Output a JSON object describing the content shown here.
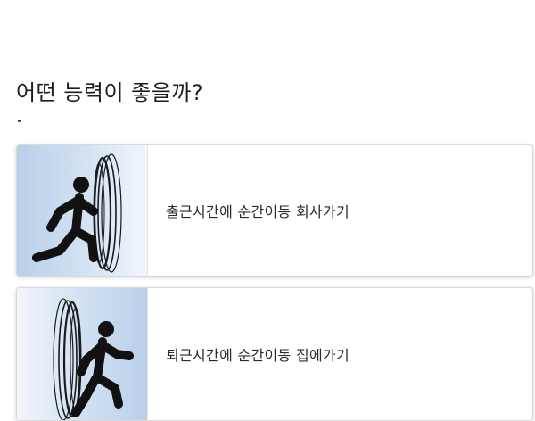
{
  "question": "어떤 능력이 좋을까?",
  "options": [
    {
      "label": "출근시간에 순간이동 회사가기",
      "icon": "running-into-portal-icon"
    },
    {
      "label": "퇴근시간에 순간이동 집에가기",
      "icon": "running-out-of-portal-icon"
    }
  ]
}
